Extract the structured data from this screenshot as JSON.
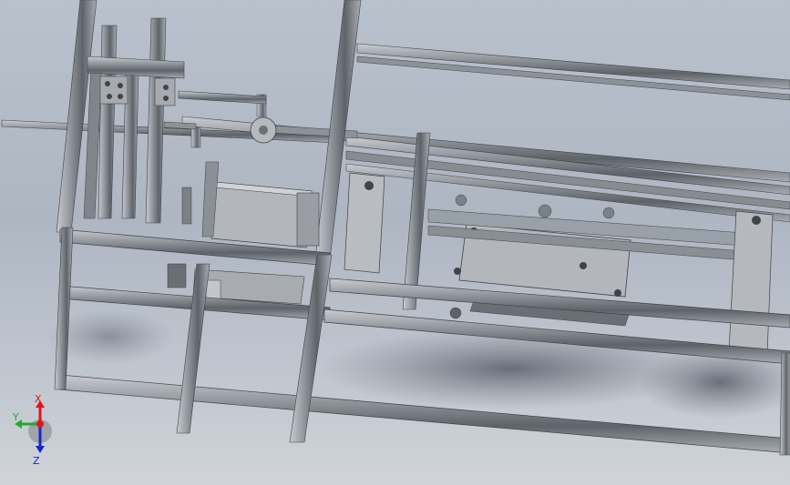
{
  "viewport": {
    "background_top": "#b9c1cd",
    "background_bottom": "#d0d4d9"
  },
  "colors": {
    "extrusion_light": "#9ea3aa",
    "extrusion_dark": "#4f545b",
    "plate": "#b7b9bd",
    "shadow": "#5a5f68",
    "axis_x": "#e0151a",
    "axis_y": "#25a82c",
    "axis_z": "#1428c8"
  },
  "triad": {
    "x_label": "X",
    "y_label": "Y",
    "z_label": "Z",
    "origin_icon": "coordinate-triad-icon"
  }
}
